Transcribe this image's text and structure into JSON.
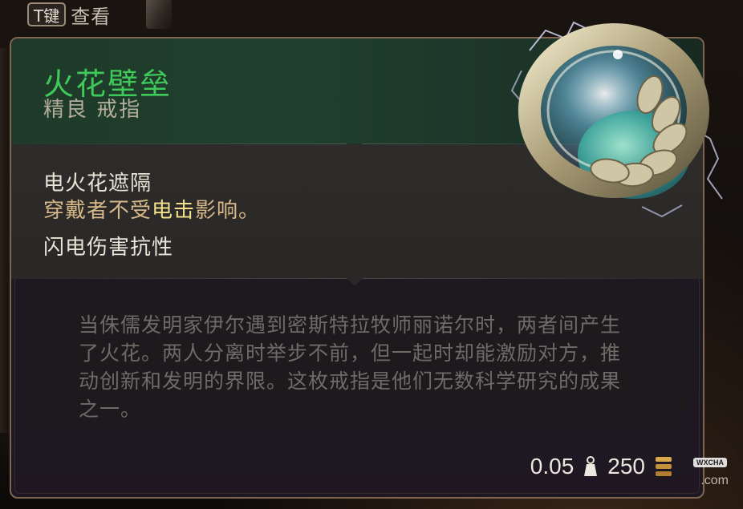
{
  "hint": {
    "key": "T键",
    "label": "查看"
  },
  "item": {
    "name": "火花壁垒",
    "subtitle": "精良 戒指",
    "name_color": "#3fc95a"
  },
  "properties": {
    "ability_title": "电火花遮隔",
    "ability_desc_prefix": "穿戴者不受",
    "ability_desc_highlight": "电击",
    "ability_desc_suffix": "影响。",
    "resistance": "闪电伤害抗性"
  },
  "lore": {
    "text": "当侏儒发明家伊尔遇到密斯特拉牧师丽诺尔时，两者间产生了火花。两人分离时举步不前，但一起时却能激励对方，推动创新和发明的界限。这枚戒指是他们无数科学研究的成果之一。"
  },
  "footer": {
    "weight": "0.05",
    "weight_icon": "weight-icon",
    "price": "250",
    "price_icon": "coin-icon"
  },
  "watermark": {
    "badge": "WXCHA",
    "domain": ".com"
  }
}
